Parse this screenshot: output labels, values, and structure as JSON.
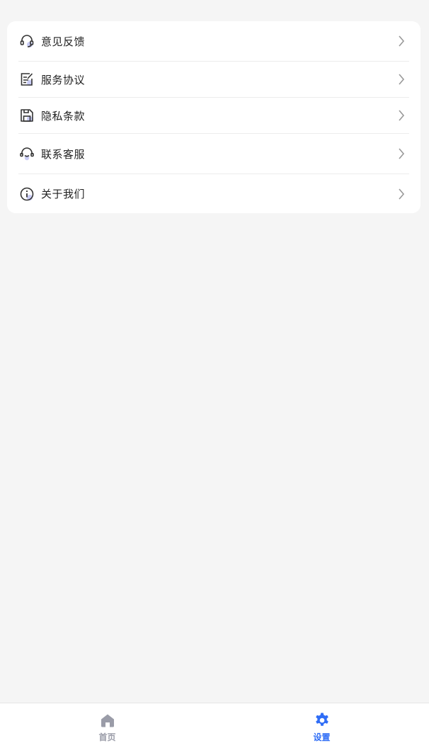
{
  "menu": {
    "items": [
      {
        "label": "意见反馈",
        "icon": "headset-icon"
      },
      {
        "label": "服务协议",
        "icon": "document-edit-icon"
      },
      {
        "label": "隐私条款",
        "icon": "save-disk-icon"
      },
      {
        "label": "联系客服",
        "icon": "customer-service-icon"
      },
      {
        "label": "关于我们",
        "icon": "info-icon"
      }
    ]
  },
  "tabbar": {
    "tabs": [
      {
        "label": "首页",
        "icon": "home-icon",
        "active": false
      },
      {
        "label": "设置",
        "icon": "gear-icon",
        "active": true
      }
    ]
  },
  "colors": {
    "background": "#f5f5f5",
    "card": "#ffffff",
    "text": "#222222",
    "icon_stroke": "#333333",
    "icon_accent": "#c9ccf5",
    "chevron": "#999999",
    "tab_active": "#2f6df6",
    "tab_inactive": "#9a9ca8"
  }
}
